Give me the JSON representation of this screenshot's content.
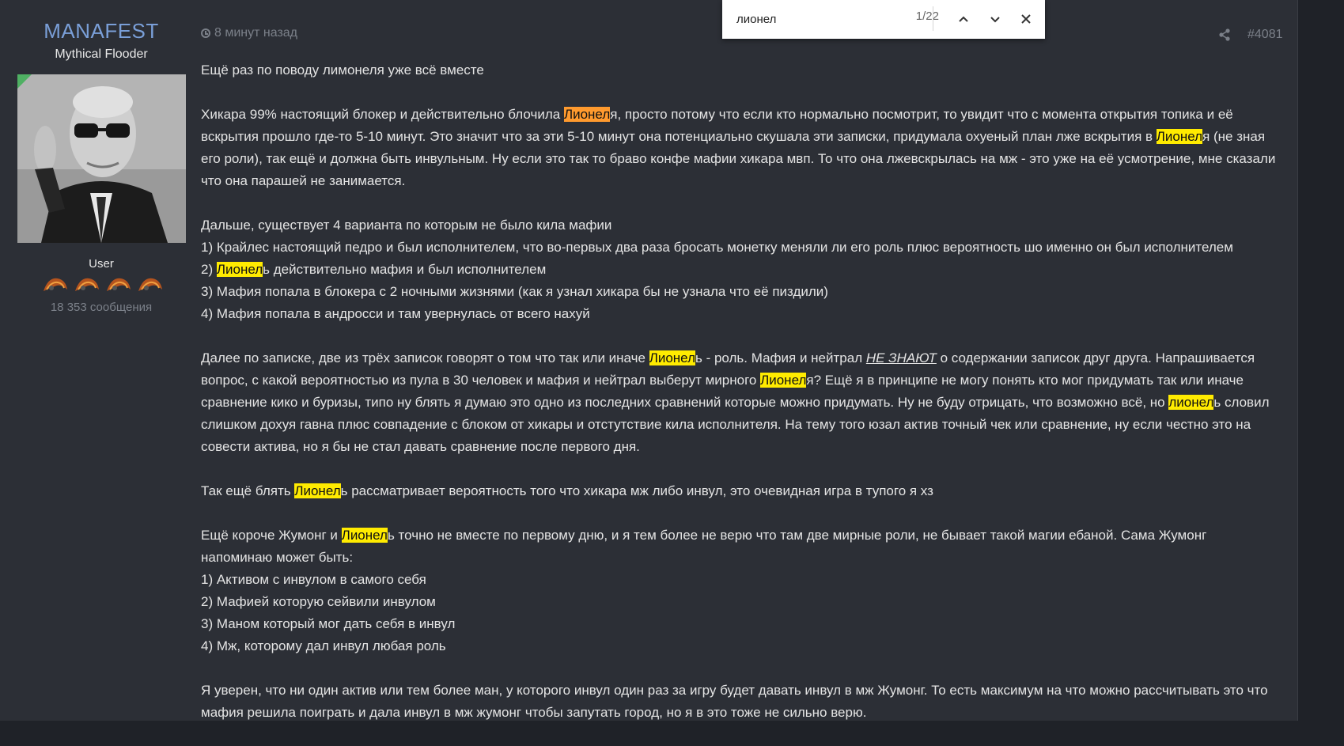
{
  "user": {
    "name": "MANAFEST",
    "title": "Mythical Flooder",
    "group": "User",
    "message_count": "18 353 сообщения"
  },
  "post": {
    "time": "8 минут назад",
    "number": "#4081"
  },
  "findbar": {
    "query": "лионел",
    "count": "1/22"
  },
  "content": {
    "p1": "Ещё раз по поводу лимонеля уже всё вместе",
    "p2": {
      "a": "Хикара 99% настоящий блокер и действительно блочила ",
      "h1": "Лионел",
      "b": "я, просто потому что если кто нормально посмотрит, то увидит что с момента открытия топика и её вскрытия прошло где-то 5-10 минут. Это значит что за эти 5-10 минут она потенциально скушала эти записки, придумала охуеный план лже вскрытия в ",
      "h2": "Лионел",
      "c": "я (не зная его роли), так ещё и должна быть инвульным. Ну если это так то браво конфе мафии хикара мвп. То что она лжевскрылась на мж - это уже на её усмотрение, мне сказали что она парашей не занимается."
    },
    "p3": {
      "intro": "Дальше, существует 4 варианта по которым не было кила мафии",
      "l1": "1) Крайлес настоящий педро и был исполнителем, что во-первых два раза бросать монетку меняли ли его роль плюс вероятность шо именно он был исполнителем",
      "l2a": "2) ",
      "l2h": "Лионел",
      "l2b": "ь действительно мафия и был исполнителем",
      "l3": "3) Мафия попала в блокера с 2 ночными жизнями (как я узнал хикара бы не узнала что её пиздили)",
      "l4": "4) Мафия попала в андросси и там увернулась от всего нахуй"
    },
    "p4": {
      "a": "Далее по записке, две из трёх записок говорят о том что так или иначе ",
      "h1": "Лионел",
      "b": "ь - роль. Мафия и нейтрал ",
      "em": "НЕ ЗНАЮТ",
      "c": " о содержании записок друг друга. Напрашивается вопрос, с какой вероятностью из пула в 30 человек и мафия и нейтрал выберут мирного ",
      "h2": "Лионел",
      "d": "я? Ещё я в принципе не могу понять кто мог придумать так или иначе сравнение кико и буризы, типо ну блять я думаю это одно из последних сравнений которые можно придумать. Ну не буду отрицать, что возможно всё, но ",
      "h3": "лионел",
      "e": "ь словил слишком дохуя гавна плюс совпадение с блоком от хикары и отстутствие кила исполнителя. На тему того юзал актив точный чек или сравнение, ну если честно это на совести актива, но я бы не стал давать сравнение после первого дня."
    },
    "p5": {
      "a": "Так ещё блять ",
      "h1": "Лионел",
      "b": "ь рассматривает вероятность того что хикара мж либо инвул, это очевидная игра в тупого я хз"
    },
    "p6": {
      "a": "Ещё короче Жумонг и ",
      "h1": "Лионел",
      "b": "ь точно не вместе по первому дню, и я тем более не верю что там две мирные роли, не бывает такой магии ебаной. Сама Жумонг напоминаю может быть:",
      "l1": "1) Активом с инвулом в самого себя",
      "l2": "2) Мафией которую сейвили инвулом",
      "l3": "3) Маном который мог дать себя в инвул",
      "l4": "4) Мж, которому дал инвул любая роль"
    },
    "p7": "Я уверен, что ни один актив или тем более ман, у которого инвул один раз за игру будет давать инвул в мж Жумонг. То есть максимум на что можно рассчитывать это что мафия решила поиграть и дала инвул в мж жумонг чтобы запутать город, но я в это тоже не сильно верю."
  },
  "colors": {
    "username": "#7a9fd8",
    "highlight": "#ffeb00",
    "highlight_current": "#ff9a2e",
    "post_bg": "#2c2f36",
    "online_badge": "#4fb063"
  },
  "icons": [
    "clock-icon",
    "share-icon",
    "chevron-up-icon",
    "chevron-down-icon",
    "close-icon",
    "award-icon"
  ]
}
